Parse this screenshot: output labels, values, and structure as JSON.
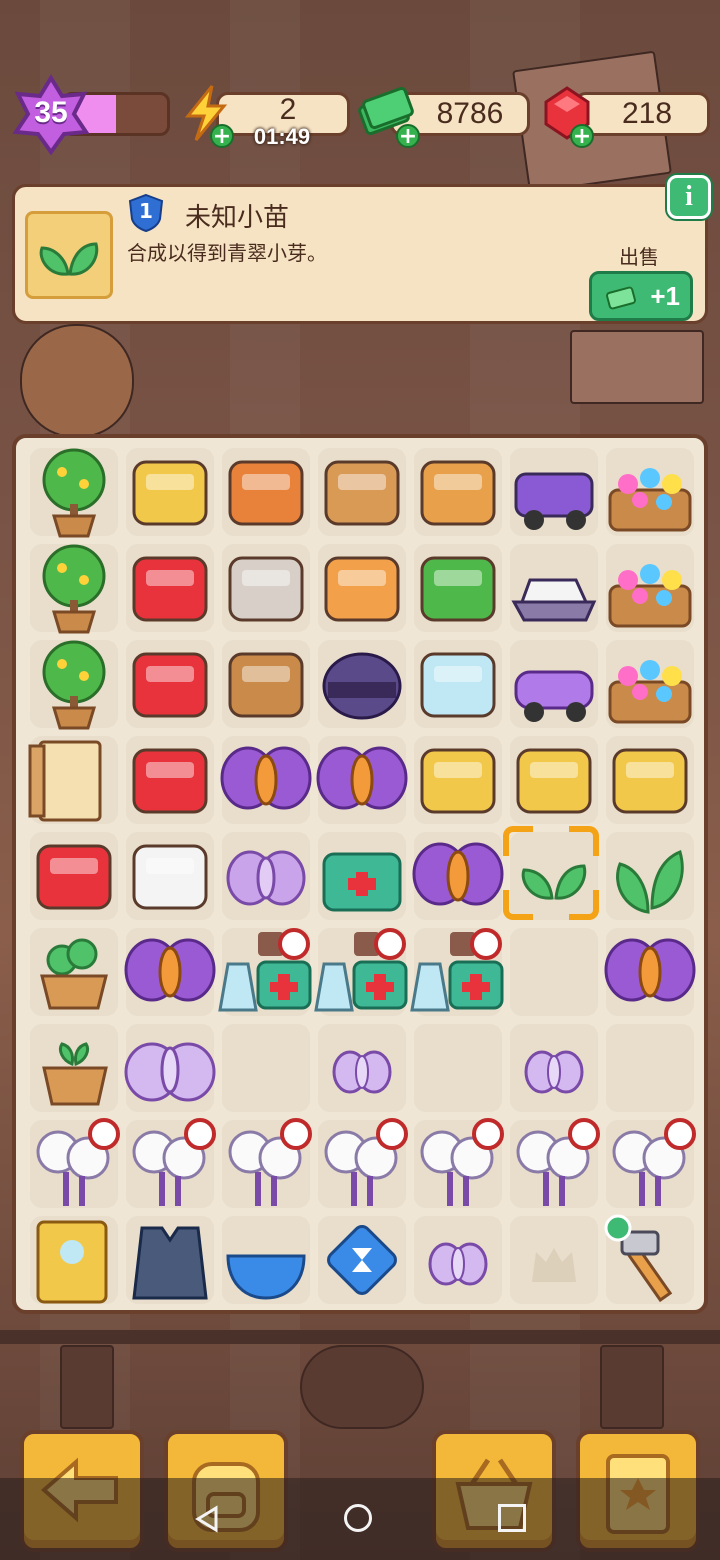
{
  "status_bar": {
    "level": "35",
    "level_progress": 0.5,
    "energy_value": "2",
    "energy_timer": "01:49",
    "cash_value": "8786",
    "gems_value": "218"
  },
  "info_panel": {
    "item_level": "1",
    "item_name": "未知小苗",
    "description": "合成以得到青翠小芽。",
    "sell_label": "出售",
    "sell_value": "+1",
    "info_button_label": "i"
  },
  "board": {
    "rows": [
      [
        "fruit-tree",
        "hair-dryer",
        "dragon-vase",
        "tea-cart",
        "wood-cart",
        "purple-jeep",
        "flower-cart"
      ],
      [
        "fruit-tree",
        "red-toolbox-broken",
        "dirty-tray",
        "paw-box",
        "green-planter-broken",
        "jet-ski",
        "flower-cart"
      ],
      [
        "fruit-tree",
        "red-toolbox",
        "soil-bag",
        "helmet",
        "blood-pressure-monitor",
        "purple-car",
        "flower-cart"
      ],
      [
        "wooden-cabinet",
        "heart-jar",
        "purple-moth",
        "purple-moth",
        "yellow-tub",
        "yellow-sink",
        "yellow-tray"
      ],
      [
        "red-glove",
        "red-tool-kit",
        "lilac-moth",
        "green-first-aid-kit",
        "purple-moth",
        "green-sprout-selected",
        "green-leaf"
      ],
      [
        "potted-clover",
        "purple-moth",
        "medicine-kit",
        "medicine-kit",
        "medicine-kit",
        "empty",
        "purple-moth"
      ],
      [
        "potted-sprout",
        "lilac-moth-large",
        "empty",
        "small-lilac-moth",
        "empty",
        "small-lilac-moth",
        "empty"
      ],
      [
        "dandelion",
        "dandelion",
        "dandelion",
        "dandelion",
        "dandelion",
        "dandelion",
        "dandelion"
      ],
      [
        "gold-cabinet",
        "armor-vest",
        "blue-bowl",
        "hourglass-gem",
        "small-lilac-moth",
        "empty-shadow",
        "hammer-done"
      ]
    ]
  },
  "bottom_buttons": [
    "back-button",
    "backpack-button",
    "shop-basket-button",
    "task-board-button"
  ],
  "colors": {
    "panel": "#f6e3c4",
    "border": "#6a3f2b",
    "accent_green": "#3fba74",
    "accent_orange": "#f3b83a",
    "level_purple": "#c25ee0"
  }
}
